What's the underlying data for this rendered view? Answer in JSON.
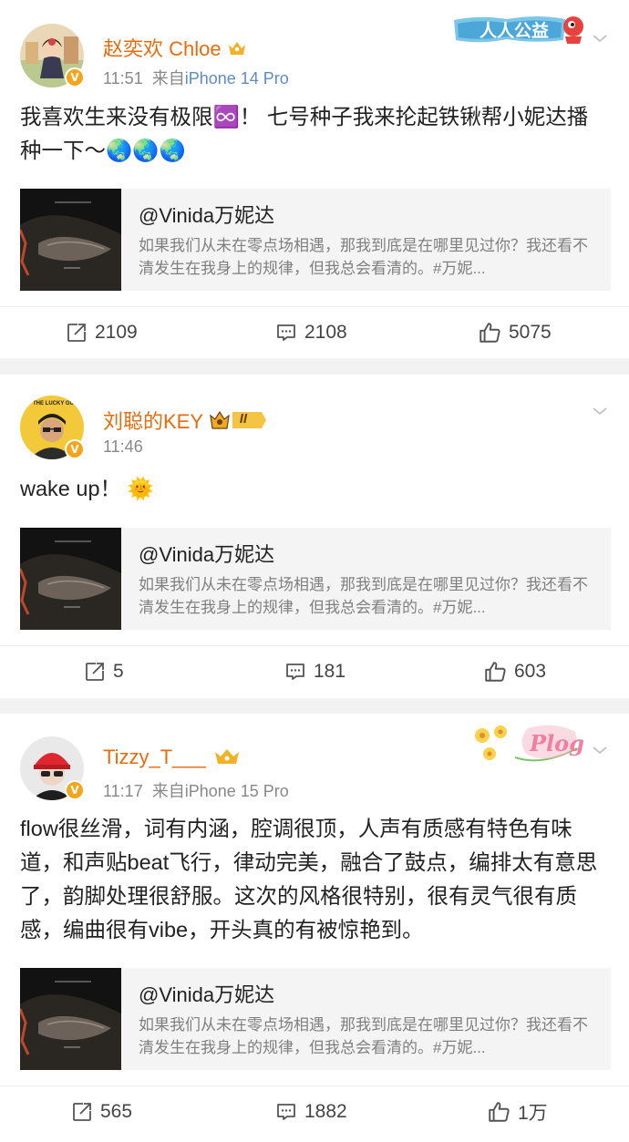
{
  "posts": [
    {
      "username": "赵奕欢 Chloe",
      "time": "11:51",
      "source_prefix": "来自",
      "source": "iPhone 14 Pro",
      "badge_text": "人人公益",
      "text": "我喜欢生来没有极限♾️！ 七号种子我来抡起铁锹帮小妮达播种一下～🌏🌏🌏",
      "quote_title": "@Vinida万妮达",
      "quote_text": "如果我们从未在零点场相遇，那我到底是在哪里见过你？我还看不清发生在我身上的规律，但我总会看清的。#万妮...",
      "reposts": "2109",
      "comments": "2108",
      "likes": "5075"
    },
    {
      "username": "刘聪的KEY",
      "time": "11:46",
      "rank_badge": "II",
      "avatar_text": "THE LUCKY GUY",
      "text": "wake up！ 🌞",
      "quote_title": "@Vinida万妮达",
      "quote_text": "如果我们从未在零点场相遇，那我到底是在哪里见过你？我还看不清发生在我身上的规律，但我总会看清的。#万妮...",
      "reposts": "5",
      "comments": "181",
      "likes": "603"
    },
    {
      "username": "Tizzy_T___",
      "time": "11:17",
      "source_prefix": "来自",
      "source": "iPhone 15 Pro",
      "badge_text": "Plog",
      "text": "flow很丝滑，词有内涵，腔调很顶，人声有质感有特色有味道，和声贴beat飞行，律动完美，融合了鼓点，编排太有意思了，韵脚处理很舒服。这次的风格很特别，很有灵气很有质感，编曲很有vibe，开头真的有被惊艳到。",
      "quote_title": "@Vinida万妮达",
      "quote_text": "如果我们从未在零点场相遇，那我到底是在哪里见过你？我还看不清发生在我身上的规律，但我总会看清的。#万妮...",
      "reposts": "565",
      "comments": "1882",
      "likes": "1万"
    }
  ],
  "colors": {
    "username": "#e86b0c",
    "link": "#5e8dc4",
    "verified": "#f4a51c",
    "background": "#f2f2f2"
  },
  "icons": [
    "verified-badge-icon",
    "crown-icon",
    "chevron-down-icon",
    "repost-icon",
    "comment-icon",
    "like-icon"
  ]
}
